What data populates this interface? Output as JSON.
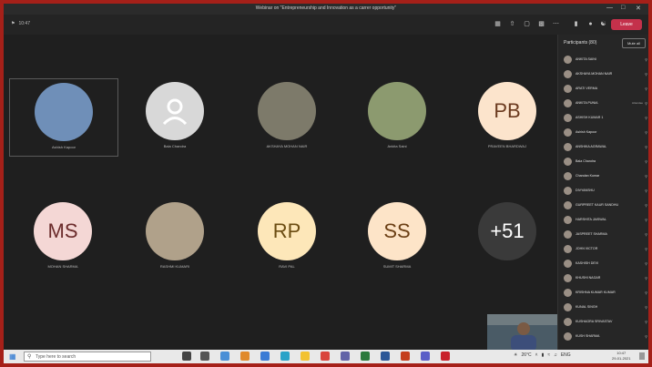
{
  "window": {
    "title": "Webinar on \"Entrepreneurship and Innovation as a carrer opportunity\"",
    "minimize_glyph": "—",
    "maximize_glyph": "□",
    "close_glyph": "✕"
  },
  "toolbar": {
    "timer": "10:47",
    "leave_label": "Leave"
  },
  "roster": {
    "header": "Participants (80)",
    "mute_all_label": "Mute all",
    "people": [
      {
        "name": "ANKITA SAINI"
      },
      {
        "name": "AKSHAYA MOHAN NAIR"
      },
      {
        "name": "ARATI VERMA"
      },
      {
        "name": "ANKITA PUNIA",
        "tag": "Attendee"
      },
      {
        "name": "ASHISH KUMAR 1"
      },
      {
        "name": "Ashish Kapoor"
      },
      {
        "name": "ANSHIKA AGRAWAL"
      },
      {
        "name": "Bala Chandra"
      },
      {
        "name": "Chandan Kumar"
      },
      {
        "name": "DIVYANSHU"
      },
      {
        "name": "GURPREET KAUR SANDHU"
      },
      {
        "name": "HARSHITA JAISWAL"
      },
      {
        "name": "JASPREET SHARMA"
      },
      {
        "name": "JOHN VICTOR"
      },
      {
        "name": "KASHISH DEVI"
      },
      {
        "name": "KHUSHI NAGAR"
      },
      {
        "name": "KRISHNA KUMAR KUMAR"
      },
      {
        "name": "KUNAL SINGH"
      },
      {
        "name": "KUSHAGRA SRIVASTAV"
      },
      {
        "name": "KUSH SHARMA"
      }
    ]
  },
  "tiles": [
    {
      "name": "Ashish Kapoor",
      "initials": "",
      "bg": "#6f8fb8",
      "active": true
    },
    {
      "name": "Bala Chandra",
      "initials": "",
      "bg": "#d8d8d8",
      "icon": "person-icon"
    },
    {
      "name": "AKSHAYA MOHAN NAIR",
      "initials": "",
      "bg": "#7d7a6a"
    },
    {
      "name": "Ankita Saini",
      "initials": "",
      "bg": "#8c9a6f"
    },
    {
      "name": "PRAVEEN BHARDWAJ",
      "initials": "PB",
      "bg": "#fce4cc",
      "fg": "#6b3a1f"
    },
    {
      "name": "MOHAN SHARMA",
      "initials": "MS",
      "bg": "#f4d7d5",
      "fg": "#6b2b2b"
    },
    {
      "name": "RASHMI KUMARI",
      "initials": "",
      "bg": "#b0a18a"
    },
    {
      "name": "RAVI PAL",
      "initials": "RP",
      "bg": "#fde7b9",
      "fg": "#6b4c12"
    },
    {
      "name": "SUMIT SHARMA",
      "initials": "SS",
      "bg": "#fde4c8",
      "fg": "#6b3f15"
    },
    {
      "name": "",
      "initials": "+51",
      "bg": "#3a3a3a",
      "fg": "#ffffff"
    }
  ],
  "taskbar": {
    "search_placeholder": "Type here to search",
    "temperature": "26°C",
    "language": "ENG",
    "time": "10:47",
    "date": "29-01-2021"
  },
  "colors": {
    "accent": "#c4314b",
    "border": "#a52019"
  }
}
